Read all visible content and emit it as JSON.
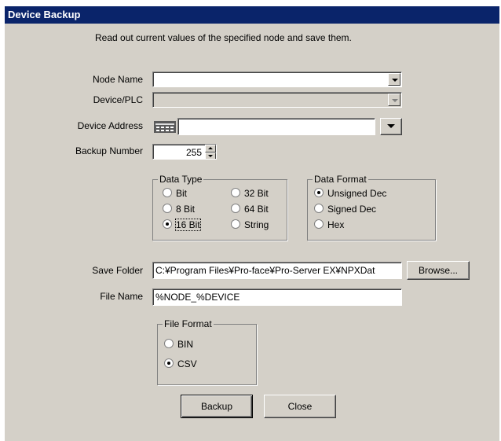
{
  "window": {
    "title": "Device Backup"
  },
  "description": "Read out current values of the specified node and save them.",
  "node_name": {
    "label": "Node Name",
    "value": ""
  },
  "device_plc": {
    "label": "Device/PLC",
    "value": ""
  },
  "device_address": {
    "label": "Device Address",
    "value": ""
  },
  "backup_number": {
    "label": "Backup Number",
    "value": "255"
  },
  "data_type": {
    "caption": "Data Type",
    "options": [
      "Bit",
      "8 Bit",
      "16 Bit",
      "32 Bit",
      "64 Bit",
      "String"
    ],
    "selected": "16 Bit"
  },
  "data_format": {
    "caption": "Data Format",
    "options": [
      "Unsigned Dec",
      "Signed Dec",
      "Hex"
    ],
    "selected": "Unsigned Dec"
  },
  "save_folder": {
    "label": "Save Folder",
    "value": "C:¥Program Files¥Pro-face¥Pro-Server EX¥NPXDat",
    "browse_label": "Browse..."
  },
  "file_name": {
    "label": "File Name",
    "value": "%NODE_%DEVICE"
  },
  "file_format": {
    "caption": "File Format",
    "options": [
      "BIN",
      "CSV"
    ],
    "selected": "CSV"
  },
  "buttons": {
    "backup": "Backup",
    "close": "Close"
  },
  "colors": {
    "titlebar": "#0a246a",
    "dialog_bg": "#d4d0c8"
  }
}
